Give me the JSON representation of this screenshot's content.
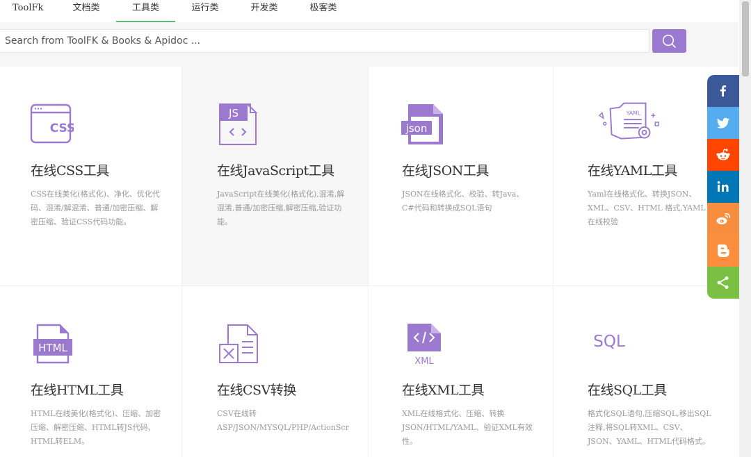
{
  "nav": {
    "brand": "ToolFk",
    "items": [
      "文档类",
      "工具类",
      "运行类",
      "开发类",
      "极客类"
    ],
    "active": "工具类"
  },
  "search": {
    "placeholder": "Search from ToolFK & Books & Apidoc ...",
    "button_icon": "search-icon"
  },
  "colors": {
    "accent": "#9b79cf",
    "active_tab": "#5fb878"
  },
  "cards": [
    {
      "icon": "css-icon",
      "title": "在线CSS工具",
      "desc": "CSS在线美化(格式化)、净化、优化代码、混淆/解混淆、普通/加密压缩、解密压缩、验证CSS代码功能。"
    },
    {
      "icon": "javascript-icon",
      "title": "在线JavaScript工具",
      "desc": "JavaScript在线美化(格式化),混淆,解混淆,普通/加密压缩,解密压缩,验证功能。"
    },
    {
      "icon": "json-icon",
      "title": "在线JSON工具",
      "desc": "JSON在线格式化、校验、转Java、C#代码和转换成SQL语句"
    },
    {
      "icon": "yaml-icon",
      "title": "在线YAML工具",
      "desc": "Yaml在线格式化、转换JSON、XML、CSV、HTML 格式,YAML在线校验"
    },
    {
      "icon": "html-icon",
      "title": "在线HTML工具",
      "desc": "HTML在线美化(格式化)、压缩、加密压缩、解密压缩、HTML转JS代码、HTML转ELM。"
    },
    {
      "icon": "csv-icon",
      "title": "在线CSV转换",
      "desc": "CSV在线转ASP/JSON/MYSQL/PHP/ActionScr"
    },
    {
      "icon": "xml-icon",
      "title": "在线XML工具",
      "desc": "XML在线格式化、压缩、转换JSON/HTML/YAML、验证XML有效性。"
    },
    {
      "icon": "sql-icon",
      "title": "在线SQL工具",
      "desc": "格式化SQL语句,压缩SQL,移出SQL注释,将SQL转XML、CSV、JSON、YAML、HTML代码格式。"
    }
  ],
  "icon_labels": {
    "css": "CSS",
    "js": "JS",
    "json": "json",
    "yaml": "YAML",
    "html": "HTML",
    "xml": "XML",
    "sql": "SQL"
  },
  "share": [
    {
      "icon": "facebook-icon",
      "color": "#3b5998"
    },
    {
      "icon": "twitter-icon",
      "color": "#55acee"
    },
    {
      "icon": "reddit-icon",
      "color": "#ff4500"
    },
    {
      "icon": "linkedin-icon",
      "color": "#0077b5"
    },
    {
      "icon": "weibo-icon",
      "color": "#f78d3e"
    },
    {
      "icon": "blogger-icon",
      "color": "#fb8f3d"
    },
    {
      "icon": "share-icon",
      "color": "#7ac143"
    }
  ]
}
